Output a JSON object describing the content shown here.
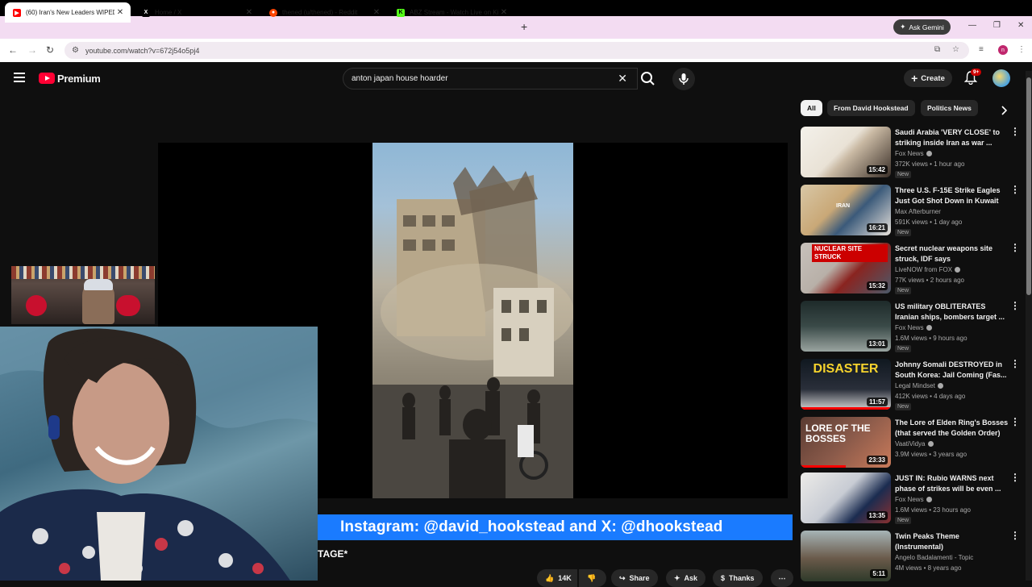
{
  "browser": {
    "tabs": [
      {
        "label": "(60) Iran's New Leaders WIPED",
        "fav": "▶",
        "fav_color": "#ff0000"
      },
      {
        "label": "Home / X",
        "fav": "X",
        "fav_color": "#000000"
      },
      {
        "label": "thened (u/thened) - Reddit",
        "fav": "●",
        "fav_color": "#ff4500"
      },
      {
        "label": "ABZ Stream - Watch Live on Ki",
        "fav": "K",
        "fav_color": "#53fc18"
      }
    ],
    "new_tab": "+",
    "gemini": "Ask Gemini",
    "url": "youtube.com/watch?v=672j54o5pj4",
    "profile": "n"
  },
  "youtube": {
    "logo_text": "Premium",
    "search_value": "anton japan house hoarder",
    "create_label": "Create",
    "notif_badge": "9+",
    "chips": [
      "All",
      "From David Hookstead",
      "Politics News"
    ],
    "ticker": "Instagram: @david_hookstead and X: @dhookstead",
    "caption_fragment": "TAGE*",
    "actions": {
      "like_count": "14K",
      "share": "Share",
      "ask": "Ask",
      "thanks": "Thanks"
    }
  },
  "recommendations": [
    {
      "title": "Saudi Arabia 'VERY CLOSE' to striking inside Iran as war ...",
      "channel": "Fox News",
      "verified": true,
      "meta": "372K views • 1 hour ago",
      "new": "New",
      "duration": "15:42",
      "thumb_overlay": ""
    },
    {
      "title": "Three U.S. F-15E Strike Eagles Just Got Shot Down in Kuwait",
      "channel": "Max Afterburner",
      "verified": false,
      "meta": "591K views • 1 day ago",
      "new": "New",
      "duration": "16:21",
      "thumb_overlay": "IRAN"
    },
    {
      "title": "Secret nuclear weapons site struck, IDF says",
      "channel": "LiveNOW from FOX",
      "verified": true,
      "meta": "77K views • 2 hours ago",
      "new": "New",
      "duration": "15:32",
      "thumb_overlay": "NUCLEAR SITE STRUCK"
    },
    {
      "title": "US military OBLITERATES Iranian ships, bombers target ...",
      "channel": "Fox News",
      "verified": true,
      "meta": "1.6M views • 9 hours ago",
      "new": "New",
      "duration": "13:01",
      "thumb_overlay": ""
    },
    {
      "title": "Johnny Somali DESTROYED in South Korea: Jail Coming (Fas...",
      "channel": "Legal Mindset",
      "verified": true,
      "meta": "412K views • 4 days ago",
      "new": "New",
      "duration": "11:57",
      "thumb_overlay": "DISASTER"
    },
    {
      "title": "The Lore of Elden Ring's Bosses (that served the Golden Order)",
      "channel": "VaatiVidya",
      "verified": true,
      "meta": "3.9M views • 3 years ago",
      "new": "",
      "duration": "23:33",
      "thumb_overlay": "LORE OF THE BOSSES"
    },
    {
      "title": "JUST IN: Rubio WARNS next phase of strikes will be even ...",
      "channel": "Fox News",
      "verified": true,
      "meta": "1.6M views • 23 hours ago",
      "new": "New",
      "duration": "13:35",
      "thumb_overlay": ""
    },
    {
      "title": "Twin Peaks Theme (Instrumental)",
      "channel": "Angelo Badalamenti - Topic",
      "verified": false,
      "meta": "4M views • 8 years ago",
      "new": "",
      "duration": "5:11",
      "thumb_overlay": ""
    }
  ],
  "rec_progress": [
    0,
    0,
    0,
    0,
    1.0,
    0.5,
    0,
    0
  ]
}
